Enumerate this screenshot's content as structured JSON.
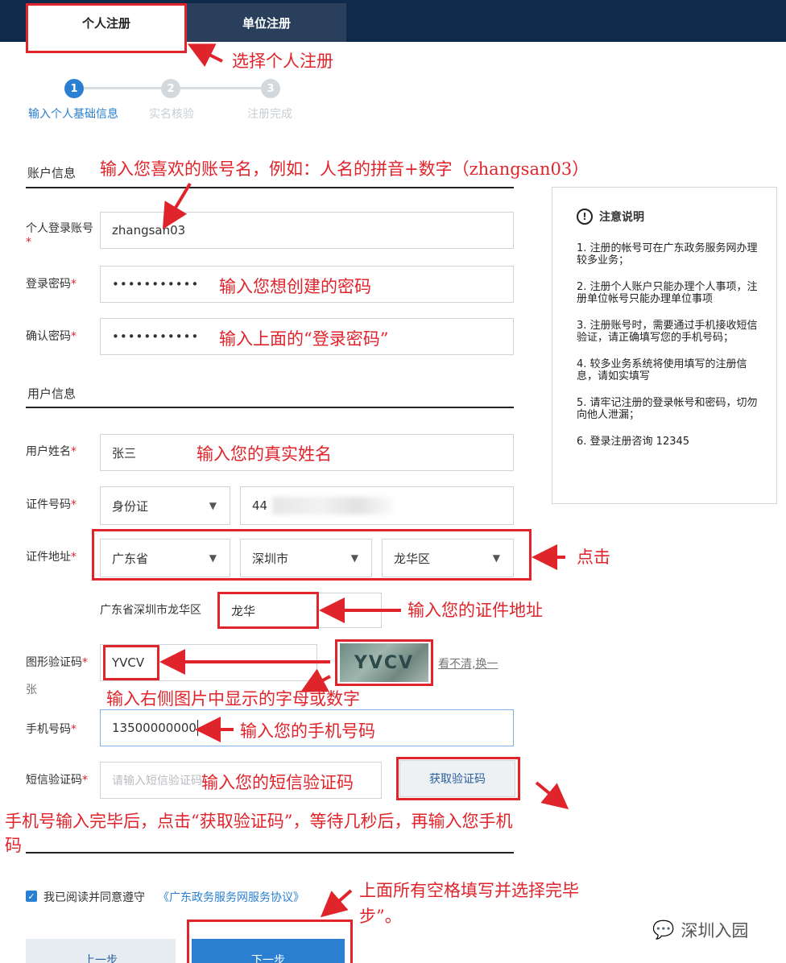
{
  "tabs": {
    "personal": "个人注册",
    "unit": "单位注册"
  },
  "steps": [
    "1",
    "2",
    "3"
  ],
  "step_labels": [
    "输入个人基础信息",
    "实名核验",
    "注册完成"
  ],
  "sections": {
    "account": "账户信息",
    "user": "用户信息"
  },
  "fields": {
    "login_account": {
      "label": "个人登录账号",
      "value": "zhangsan03"
    },
    "login_password": {
      "label": "登录密码",
      "value": "•••••••••••"
    },
    "confirm_password": {
      "label": "确认密码",
      "value": "•••••••••••"
    },
    "user_name": {
      "label": "用户姓名",
      "value": "张三"
    },
    "id_number": {
      "label": "证件号码",
      "type_value": "身份证",
      "value": "44"
    },
    "id_address": {
      "label": "证件地址",
      "province": "广东省",
      "city": "深圳市",
      "district": "龙华区",
      "prefix": "广东省深圳市龙华区",
      "detail": "龙华"
    },
    "captcha": {
      "label": "图形验证码",
      "value": "YVCV",
      "image_text": "YVCV",
      "refresh": "看不清,换一张"
    },
    "phone": {
      "label": "手机号码",
      "value": "13500000000"
    },
    "sms_code": {
      "label": "短信验证码",
      "placeholder": "请输入短信验证码",
      "button": "获取验证码"
    }
  },
  "required_mark": "*",
  "notice": {
    "title": "注意说明",
    "items": [
      "1. 注册的帐号可在广东政务服务网办理较多业务；",
      "2. 注册个人账户只能办理个人事项，注册单位帐号只能办理单位事项",
      "3. 注册账号时，需要通过手机接收短信验证，请正确填写您的手机号码；",
      "4. 较多业务系统将使用填写的注册信息，请如实填写",
      "5. 请牢记注册的登录帐号和密码，切勿向他人泄漏；",
      "6. 登录注册咨询 12345"
    ]
  },
  "agreement": {
    "text": "我已阅读并同意遵守",
    "link": "《广东政务服务网服务协议》"
  },
  "buttons": {
    "prev": "上一步",
    "next": "下一步"
  },
  "annotations": {
    "choose_personal": "选择个人注册",
    "account_name": "输入您喜欢的账号名，例如：人名的拼音+数字（zhangsan03）",
    "password": "输入您想创建的密码",
    "confirm": "输入上面的“登录密码”",
    "real_name": "输入您的真实姓名",
    "click": "点击",
    "address": "输入您的证件地址",
    "captcha": "输入右侧图片中显示的字母或数字",
    "phone": "输入您的手机号码",
    "sms": "输入您的短信验证码",
    "after_phone_1": "手机号输入完毕后，点击“获取验证码”，等待几秒后，再输入您手机",
    "after_phone_2": "码",
    "finish_1": "上面所有空格填写并选择完毕",
    "finish_2": "步”。"
  },
  "watermark": "深圳入园",
  "colors": {
    "accent": "#2a7fd1",
    "annotation": "#e0242b",
    "topbar": "#0f2a4a"
  }
}
